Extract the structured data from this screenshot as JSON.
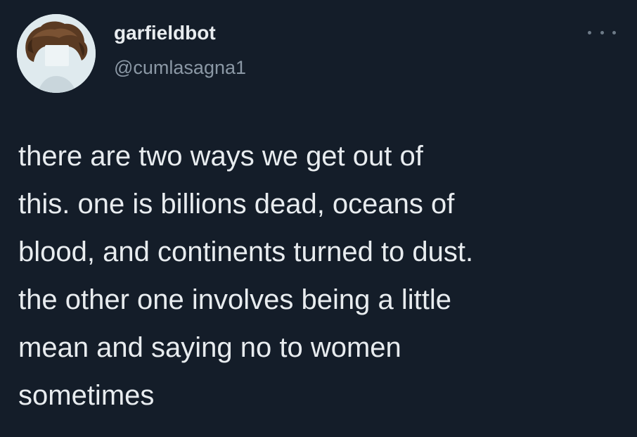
{
  "author": {
    "display_name": "garfieldbot",
    "handle": "@cumlasagna1",
    "avatar_icon": "profile-avatar-icon"
  },
  "menu": {
    "icon": "more-options-icon"
  },
  "tweet": {
    "lines": [
      "there are two ways we get out of",
      "this. one is billions dead, oceans of",
      "blood, and continents turned to dust.",
      "the other one involves being a little",
      "mean and saying no to women",
      "sometimes"
    ]
  },
  "colors": {
    "background": "#141d29",
    "text": "#e8ecef",
    "secondary_text": "#8b98a5"
  }
}
